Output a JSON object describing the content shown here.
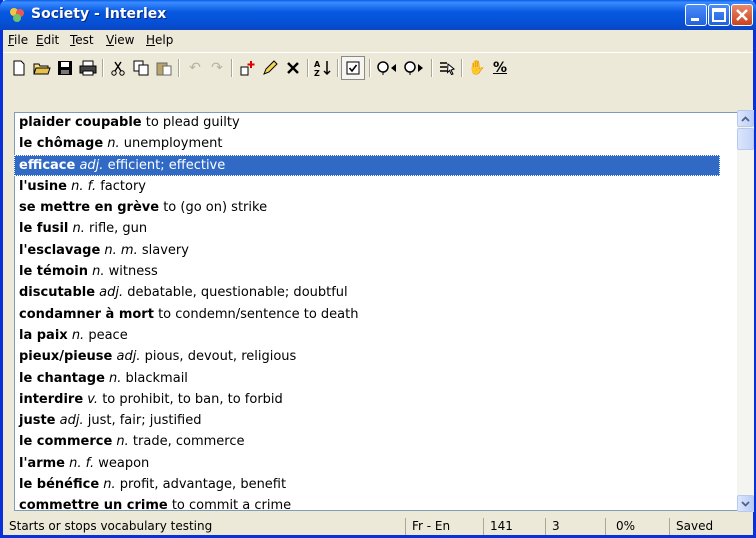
{
  "window": {
    "title": "Society - Interlex",
    "buttons": [
      "minimize-icon",
      "maximize-icon",
      "close-icon"
    ]
  },
  "menu": [
    {
      "label": "File",
      "key": "F"
    },
    {
      "label": "Edit",
      "key": "E"
    },
    {
      "label": "Test",
      "key": "T"
    },
    {
      "label": "View",
      "key": "V"
    },
    {
      "label": "Help",
      "key": "H"
    }
  ],
  "toolbar": [
    {
      "name": "new-icon",
      "glyph": "🗋"
    },
    {
      "name": "open-icon",
      "glyph": "📂"
    },
    {
      "name": "save-icon",
      "glyph": "💾"
    },
    {
      "name": "print-icon",
      "glyph": "🖶"
    },
    {
      "name": "cut-icon",
      "glyph": "✂"
    },
    {
      "name": "copy-icon",
      "glyph": "⧉"
    },
    {
      "name": "paste-icon",
      "glyph": "📋"
    },
    {
      "name": "undo-icon",
      "glyph": "↶"
    },
    {
      "name": "redo-icon",
      "glyph": "↷"
    },
    {
      "name": "add-entry-icon",
      "glyph": "⊞"
    },
    {
      "name": "edit-entry-icon",
      "glyph": "✎"
    },
    {
      "name": "delete-entry-icon",
      "glyph": "✕"
    },
    {
      "name": "sort-icon",
      "glyph": "↓"
    },
    {
      "name": "test-toggle-icon",
      "glyph": "☑"
    },
    {
      "name": "previous-icon",
      "glyph": "◂"
    },
    {
      "name": "next-icon",
      "glyph": "▸"
    },
    {
      "name": "select-icon",
      "glyph": "☰"
    },
    {
      "name": "hand-icon",
      "glyph": "✋"
    },
    {
      "name": "percent-icon",
      "glyph": "%"
    }
  ],
  "entries": [
    {
      "term": "plaider coupable",
      "pos": "",
      "def": " to plead guilty"
    },
    {
      "term": "le chômage",
      "pos": " n.",
      "def": " unemployment"
    },
    {
      "term": "efficace",
      "pos": " adj.",
      "def": " efficient; effective",
      "selected": true
    },
    {
      "term": "l'usine",
      "pos": " n. f.",
      "def": " factory"
    },
    {
      "term": "se mettre en grève",
      "pos": "",
      "def": " to (go on) strike"
    },
    {
      "term": "le fusil",
      "pos": " n.",
      "def": " rifle, gun"
    },
    {
      "term": "l'esclavage",
      "pos": " n. m.",
      "def": " slavery"
    },
    {
      "term": "le témoin",
      "pos": " n.",
      "def": " witness"
    },
    {
      "term": "discutable",
      "pos": " adj.",
      "def": " debatable, questionable; doubtful"
    },
    {
      "term": "condamner à mort",
      "pos": "",
      "def": " to condemn/sentence to death"
    },
    {
      "term": "la paix",
      "pos": " n.",
      "def": " peace"
    },
    {
      "term": "pieux/pieuse",
      "pos": " adj.",
      "def": " pious, devout, religious"
    },
    {
      "term": "le chantage",
      "pos": " n.",
      "def": " blackmail"
    },
    {
      "term": "interdire",
      "pos": " v.",
      "def": " to prohibit, to ban, to forbid"
    },
    {
      "term": "juste",
      "pos": " adj.",
      "def": " just, fair; justified"
    },
    {
      "term": "le commerce",
      "pos": " n.",
      "def": " trade, commerce"
    },
    {
      "term": "l'arme",
      "pos": " n. f.",
      "def": " weapon"
    },
    {
      "term": "le bénéfice",
      "pos": " n.",
      "def": " profit, advantage, benefit"
    },
    {
      "term": "commettre un crime",
      "pos": "",
      "def": " to commit a crime"
    }
  ],
  "status": {
    "message": "Starts or stops vocabulary testing",
    "direction": "Fr - En",
    "count": "141",
    "index": "3",
    "percent": "0%",
    "state": "Saved"
  },
  "colors": {
    "selection": "#316ac5",
    "title_bar": "#0858e0"
  }
}
